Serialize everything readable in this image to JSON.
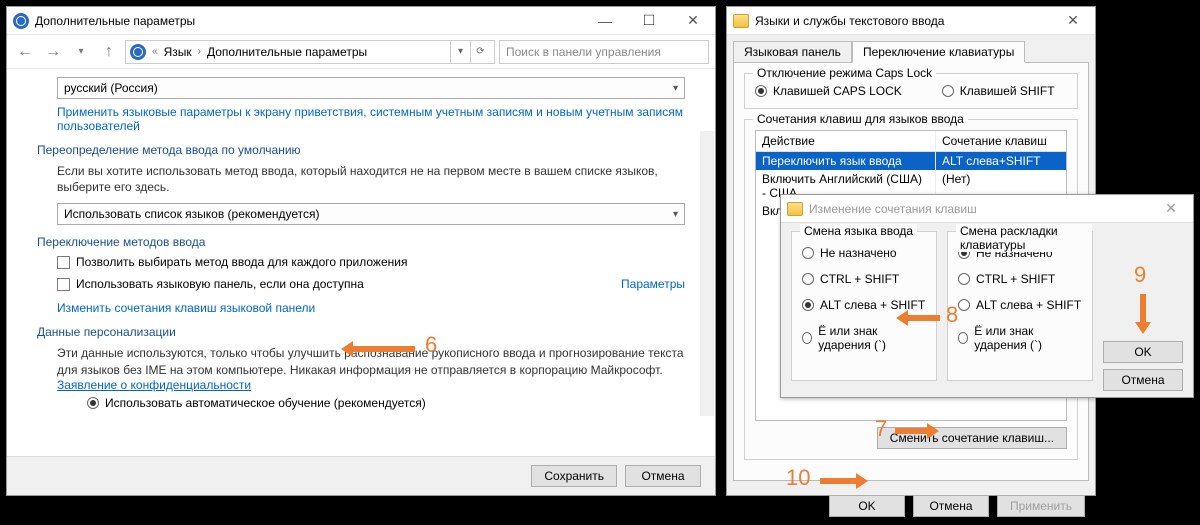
{
  "left": {
    "title": "Дополнительные параметры",
    "breadcrumb": {
      "item1": "Язык",
      "item2": "Дополнительные параметры",
      "search_placeholder": "Поиск в панели управления"
    },
    "lang_dropdown": "русский (Россия)",
    "apply_link": "Применить языковые параметры к экрану приветствия, системным учетным записям и новым учетным записям пользователей",
    "sec_override": "Переопределение метода ввода по умолчанию",
    "override_text": "Если вы хотите использовать метод ввода, который находится не на первом месте в вашем списке языков, выберите его здесь.",
    "override_dropdown": "Использовать список языков (рекомендуется)",
    "sec_switch": "Переключение методов ввода",
    "cb1": "Позволить выбирать метод ввода для каждого приложения",
    "cb2": "Использовать языковую панель, если она доступна",
    "params_link": "Параметры",
    "change_hotkeys_link": "Изменить сочетания клавиш языковой панели",
    "sec_personal": "Данные персонализации",
    "personal_text": "Эти данные используются, только чтобы улучшить распознавание рукописного ввода и прогнозирование текста для языков без IME на этом компьютере. Никакая информация не отправляется в корпорацию Майкрософт.",
    "privacy_link": "Заявление о конфиденциальности",
    "radio1": "Использовать автоматическое обучение (рекомендуется)",
    "save": "Сохранить",
    "cancel": "Отмена"
  },
  "right1": {
    "title": "Языки и службы текстового ввода",
    "tab1": "Языковая панель",
    "tab2": "Переключение клавиатуры",
    "caps_group": "Отключение режима Caps Lock",
    "caps_r1": "Клавишей CAPS LOCK",
    "caps_r2": "Клавишей SHIFT",
    "hotkeys_group": "Сочетания клавиш для языков ввода",
    "col_action": "Действие",
    "col_combo": "Сочетание клавиш",
    "rows": [
      {
        "a": "Переключить язык ввода",
        "b": "ALT слева+SHIFT"
      },
      {
        "a": "Включить Английский (США) - США",
        "b": "(Нет)"
      },
      {
        "a": "Вклю",
        "b": ""
      }
    ],
    "change_btn": "Сменить сочетание клавиш...",
    "ok": "OK",
    "cancel": "Отмена",
    "apply": "Применить"
  },
  "right2": {
    "title": "Изменение сочетания клавиш",
    "grp1": "Смена языка ввода",
    "grp2": "Смена раскладки клавиатуры",
    "r_none": "Не назначено",
    "r_ctrl": "CTRL + SHIFT",
    "r_alt": "ALT слева + SHIFT",
    "r_accent": "Ё или знак ударения (`)",
    "ok": "OK",
    "cancel": "Отмена"
  },
  "annot": {
    "n6": "6",
    "n7": "7",
    "n8": "8",
    "n9": "9",
    "n10": "10"
  }
}
